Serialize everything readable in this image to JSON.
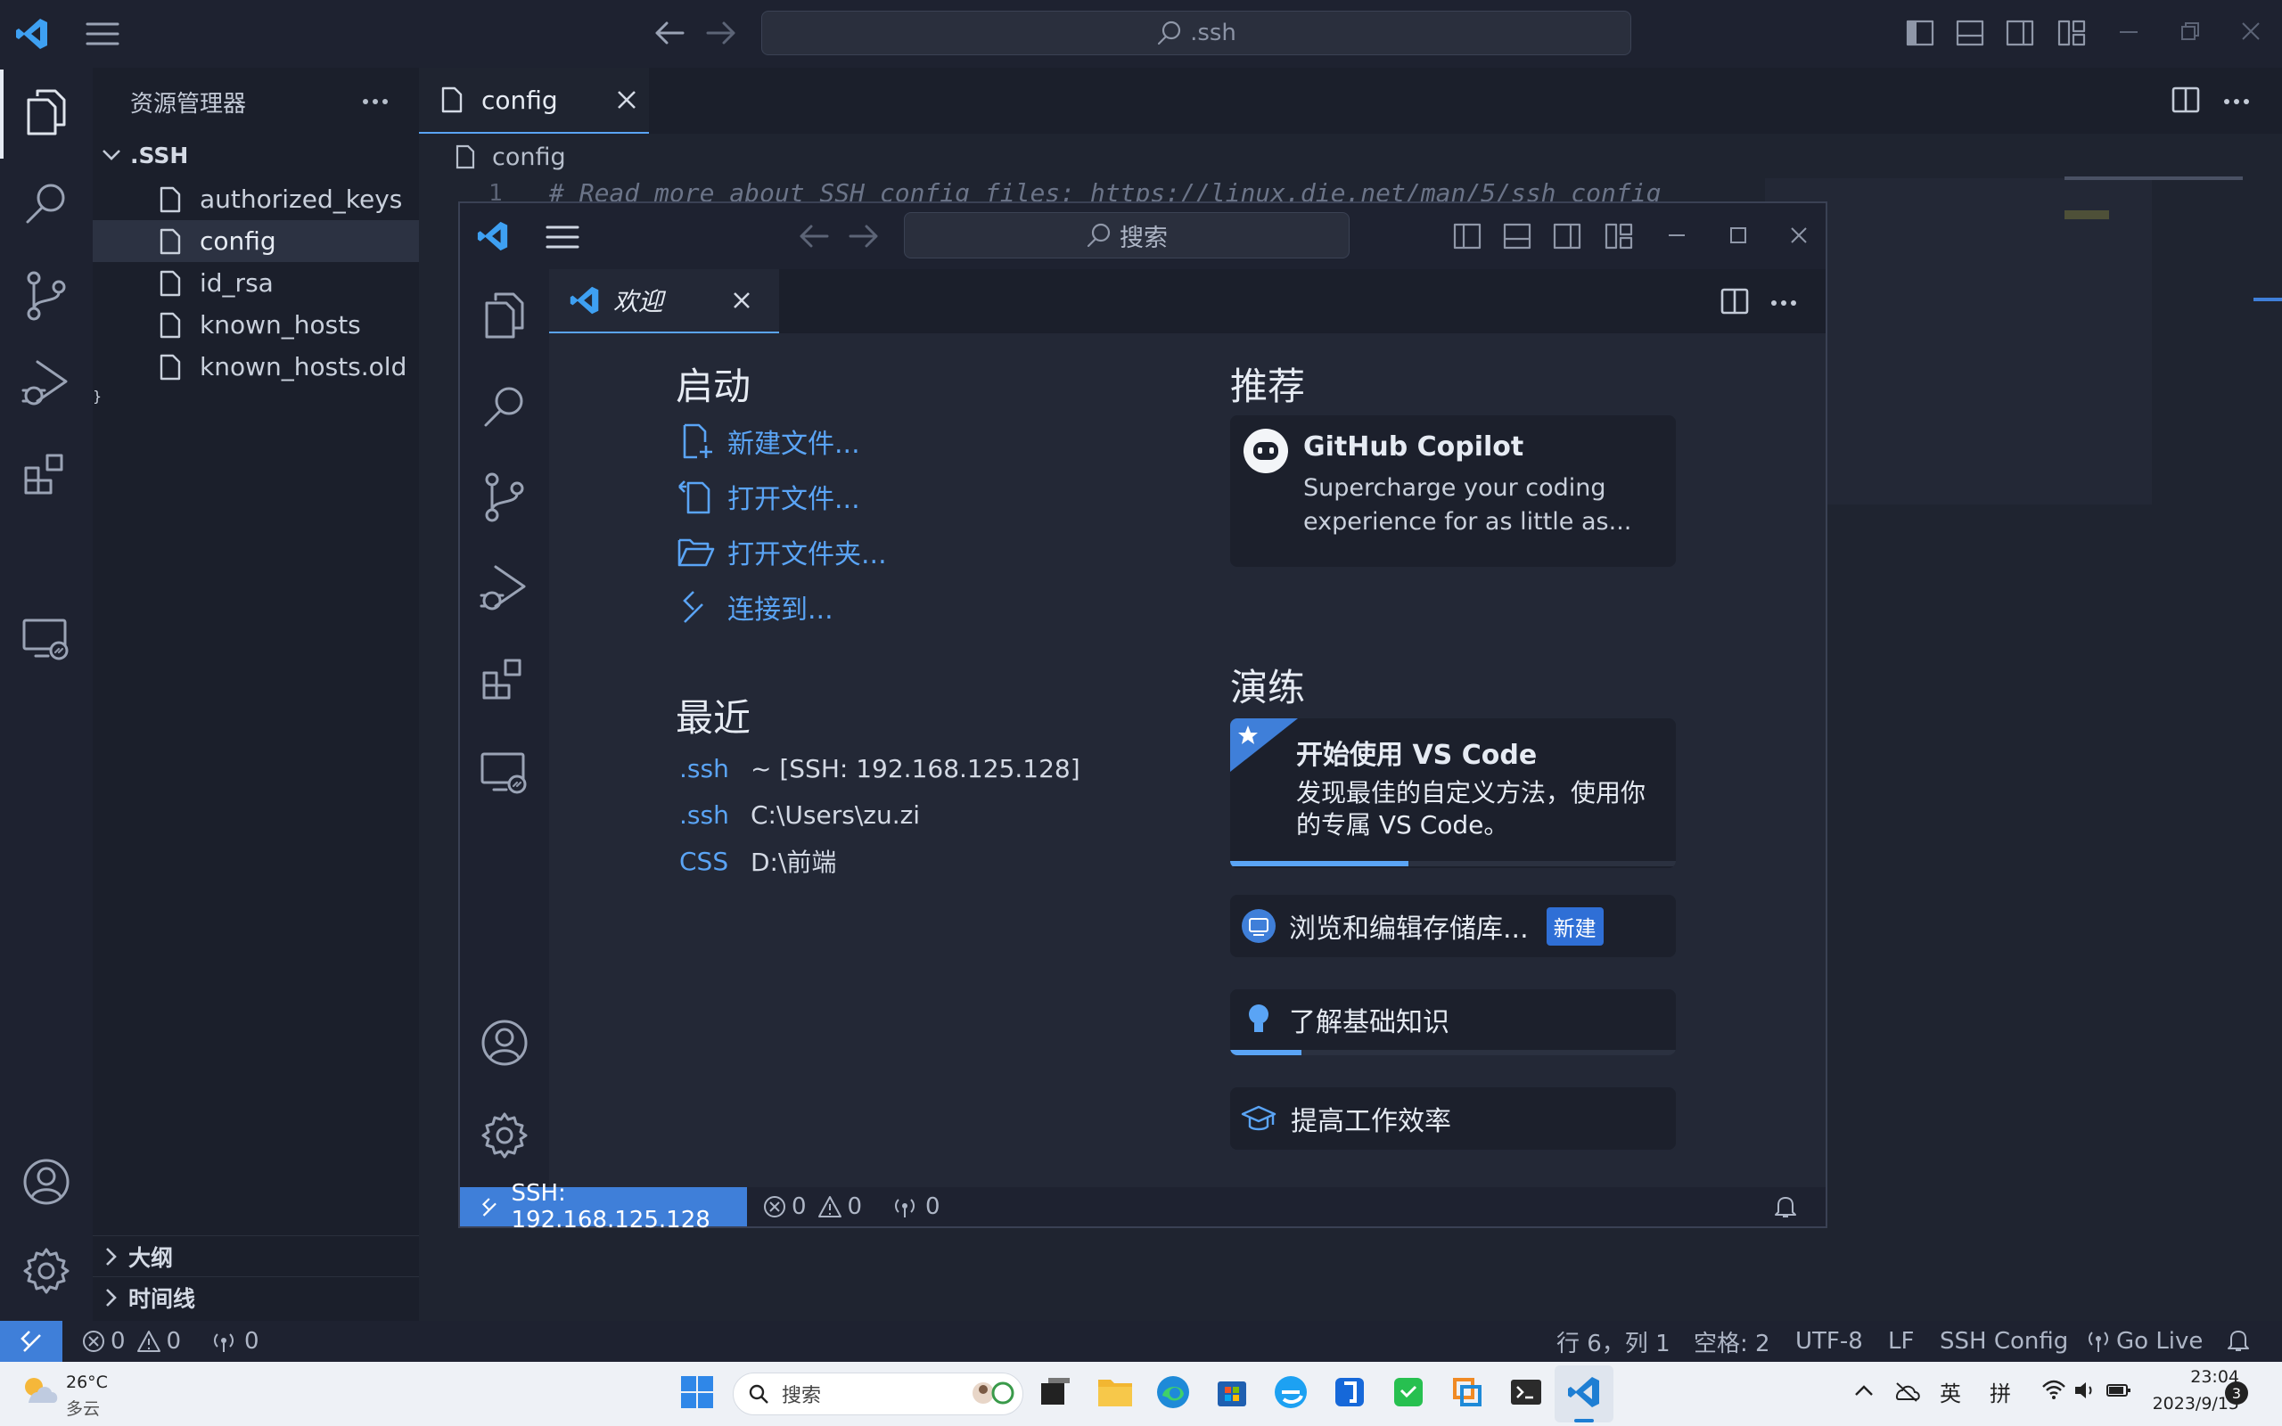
{
  "titlebar": {
    "search_text": ".ssh"
  },
  "explorer": {
    "title": "资源管理器",
    "folder": ".SSH",
    "files": [
      "authorized_keys",
      "config",
      "id_rsa",
      "known_hosts",
      "known_hosts.old"
    ],
    "selected_file": "config",
    "outline_label": "大纲",
    "timeline_label": "时间线"
  },
  "editor": {
    "tab_label": "config",
    "breadcrumb": "config",
    "line_number": "1",
    "line_text": "# Read more about SSH config files: https://linux.die.net/man/5/ssh_config"
  },
  "inner_window": {
    "search_text": "搜索",
    "tab_label": "欢迎",
    "start": {
      "heading": "启动",
      "items": [
        "新建文件...",
        "打开文件...",
        "打开文件夹...",
        "连接到..."
      ]
    },
    "recent": {
      "heading": "最近",
      "items": [
        {
          "name": ".ssh",
          "path": "~ [SSH: 192.168.125.128]"
        },
        {
          "name": ".ssh",
          "path": "C:\\Users\\zu.zi"
        },
        {
          "name": "CSS",
          "path": "D:\\前端"
        }
      ]
    },
    "recommend": {
      "heading": "推荐",
      "card_title": "GitHub Copilot",
      "card_desc_1": "Supercharge your coding",
      "card_desc_2": "experience for as little as..."
    },
    "walkthroughs": {
      "heading": "演练",
      "getting_started_title": "开始使用 VS Code",
      "getting_started_desc_1": "发现最佳的自定义方法，使用你",
      "getting_started_desc_2": "的专属 VS Code。",
      "getting_started_progress": 0.4,
      "browse_repos": "浏览和编辑存储库...",
      "browse_badge": "新建",
      "fundamentals": "了解基础知识",
      "fundamentals_progress": 0.16,
      "productivity": "提高工作效率"
    },
    "status": {
      "remote": "SSH: 192.168.125.128",
      "errors": "0",
      "warnings": "0",
      "ports": "0"
    }
  },
  "statusbar": {
    "errors": "0",
    "warnings": "0",
    "ports": "0",
    "position": "行 6，列 1",
    "indent": "空格: 2",
    "encoding": "UTF-8",
    "eol": "LF",
    "language": "SSH Config",
    "go_live": "Go Live"
  },
  "taskbar": {
    "weather_temp": "26°C",
    "weather_desc": "多云",
    "search_placeholder": "搜索",
    "ime_lang": "英",
    "ime_mode": "拼",
    "time": "23:04",
    "date": "2023/9/15",
    "notification_count": "3"
  },
  "colors": {
    "accent": "#5aa4f5",
    "remote": "#3f7fd9",
    "badge": "#2f6fd6"
  }
}
